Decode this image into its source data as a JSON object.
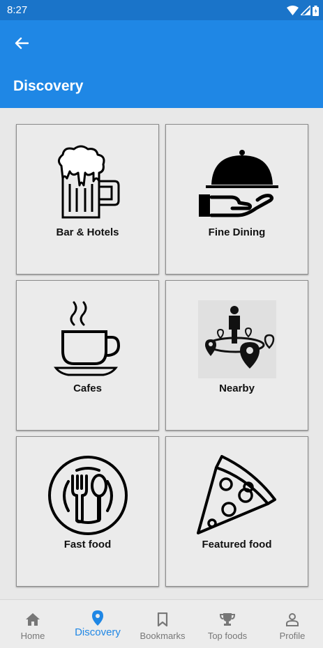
{
  "status_bar": {
    "time": "8:27"
  },
  "app_bar": {
    "title": "Discovery"
  },
  "categories": [
    {
      "label": "Bar & Hotels",
      "icon": "beer-mug-icon"
    },
    {
      "label": "Fine Dining",
      "icon": "cloche-icon"
    },
    {
      "label": "Cafes",
      "icon": "coffee-cup-icon"
    },
    {
      "label": "Nearby",
      "icon": "location-pins-icon"
    },
    {
      "label": "Fast food",
      "icon": "fork-spoon-icon"
    },
    {
      "label": "Featured food",
      "icon": "pizza-slice-icon"
    }
  ],
  "bottom_nav": {
    "active_color": "#1f87e5",
    "items": [
      {
        "label": "Home",
        "icon": "home-icon"
      },
      {
        "label": "Discovery",
        "icon": "location-pin-icon",
        "active": true
      },
      {
        "label": "Bookmarks",
        "icon": "bookmark-icon"
      },
      {
        "label": "Top foods",
        "icon": "trophy-icon"
      },
      {
        "label": "Profile",
        "icon": "person-icon"
      }
    ]
  },
  "colors": {
    "status_bar": "#1a74c9",
    "app_bar": "#1f87e5",
    "background": "#e8e8e8"
  }
}
